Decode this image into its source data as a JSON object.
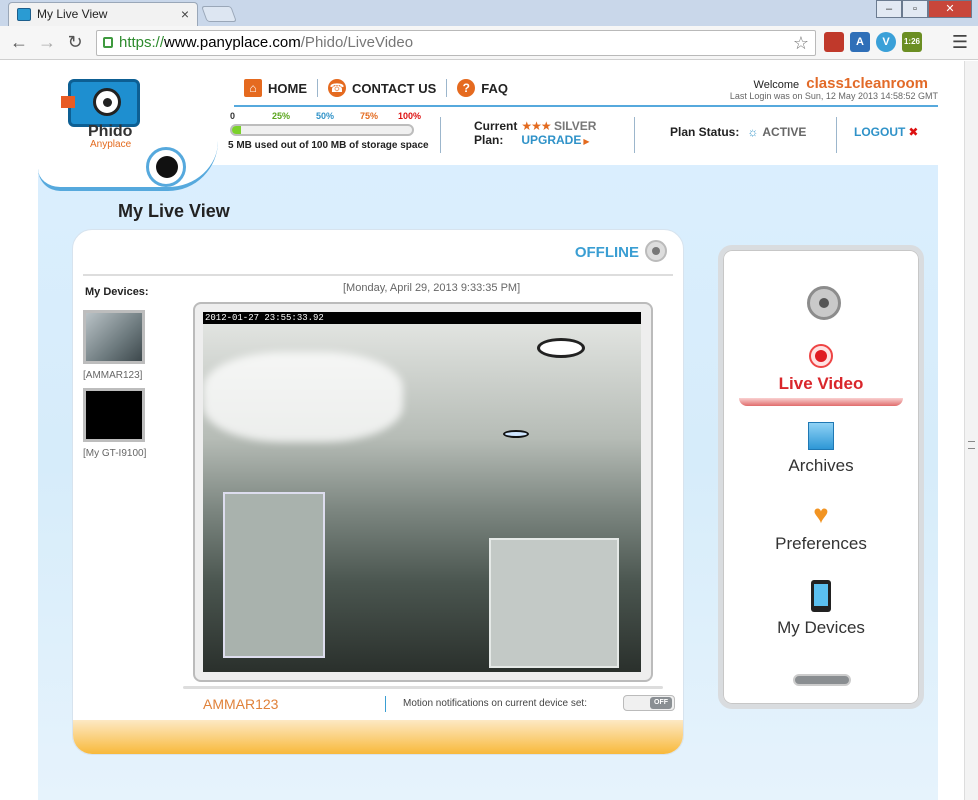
{
  "browser": {
    "tab_title": "My Live View",
    "tab_close": "×",
    "url_https": "https://",
    "url_host": "www.panyplace.com",
    "url_path": "/Phido/LiveVideo",
    "window_minimize": "–",
    "window_maximize": "▫",
    "window_close": "✕",
    "ext_badge": "1:26"
  },
  "header": {
    "logo_name": "Phido",
    "logo_sub": "Anyplace",
    "nav": [
      {
        "label": "HOME"
      },
      {
        "label": "CONTACT US"
      },
      {
        "label": "FAQ"
      }
    ],
    "welcome_label": "Welcome",
    "username": "class1cleanroom",
    "last_login": "Last Login was on Sun, 12 May 2013 14:58:52 GMT"
  },
  "storage": {
    "ticks": [
      "0",
      "25%",
      "50%",
      "75%",
      "100%"
    ],
    "used_fraction": 0.05,
    "text": "5 MB used out of 100 MB of storage space"
  },
  "plan": {
    "current_label": "Current",
    "plan_label": "Plan:",
    "stars": "★★★",
    "tier": "SILVER",
    "upgrade": "UPGRADE",
    "status_label": "Plan Status:",
    "status_value": "ACTIVE",
    "logout": "LOGOUT"
  },
  "main": {
    "title": "My Live View",
    "connection_status": "OFFLINE",
    "devices_label": "My Devices:",
    "devices": [
      {
        "caption": "[AMMAR123]"
      },
      {
        "caption": "[My GT-I9100]"
      }
    ],
    "timestamp": "[Monday, April 29, 2013 9:33:35 PM]",
    "video_overlay": "2012-01-27 23:55:33.92",
    "device_name": "AMMAR123",
    "motion_label": "Motion notifications on current device set:",
    "motion_toggle": "OFF"
  },
  "side_menu": [
    {
      "label": "Live Video",
      "active": true
    },
    {
      "label": "Archives",
      "active": false
    },
    {
      "label": "Preferences",
      "active": false
    },
    {
      "label": "My Devices",
      "active": false
    }
  ],
  "colors": {
    "accent_orange": "#e36a1e",
    "accent_blue": "#3a9ed3",
    "active_red": "#d9262b",
    "storage_green": "#7bd12b"
  }
}
